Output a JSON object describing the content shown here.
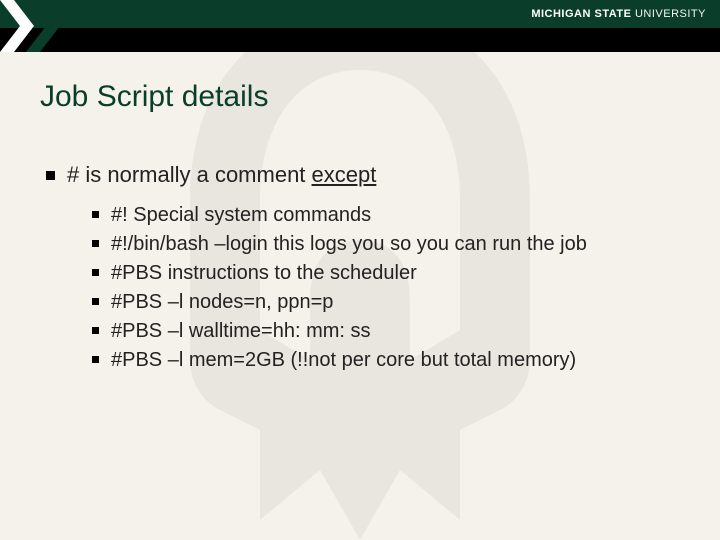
{
  "header": {
    "university_bold": "MICHIGAN STATE",
    "university_thin": " UNIVERSITY"
  },
  "title": "Job Script details",
  "main": {
    "prefix": "# is normally a comment ",
    "except": "except"
  },
  "subitems": [
    "#! Special system commands",
    "#!/bin/bash –login  this logs you so you can run the job",
    "#PBS  instructions to the scheduler",
    "#PBS –l nodes=n, ppn=p",
    "#PBS –l walltime=hh: mm: ss",
    "#PBS –l mem=2GB (!!not per core but total memory)"
  ]
}
